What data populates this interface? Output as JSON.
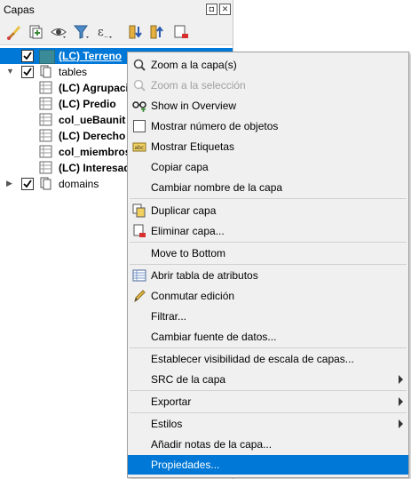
{
  "panel": {
    "title": "Capas",
    "float_glyph": "◘",
    "close_glyph": "✕"
  },
  "toolbar": {
    "tools": [
      "brush-icon",
      "add-group-icon",
      "eye-icon",
      "filter-icon",
      "expression-icon",
      "expand-all-icon",
      "collapse-all-icon",
      "remove-layer-icon"
    ]
  },
  "tree": {
    "items": [
      {
        "label": "(LC) Terreno",
        "selected": true
      },
      {
        "label": "tables"
      },
      {
        "label": "(LC) Agrupación"
      },
      {
        "label": "(LC) Predio"
      },
      {
        "label": "col_ueBaunit"
      },
      {
        "label": "(LC) Derecho"
      },
      {
        "label": "col_miembros"
      },
      {
        "label": "(LC) Interesado"
      },
      {
        "label": "domains"
      }
    ]
  },
  "menu": {
    "items": [
      {
        "label": "Zoom a la capa(s)"
      },
      {
        "label": "Zoom a la selección",
        "disabled": true
      },
      {
        "label": "Show in Overview"
      },
      {
        "label": "Mostrar número de objetos"
      },
      {
        "label": "Mostrar Etiquetas"
      },
      {
        "label": "Copiar capa"
      },
      {
        "label": "Cambiar nombre de la capa"
      },
      {
        "label": "Duplicar capa"
      },
      {
        "label": "Eliminar capa..."
      },
      {
        "label": "Move to Bottom"
      },
      {
        "label": "Abrir tabla de atributos"
      },
      {
        "label": "Conmutar edición"
      },
      {
        "label": "Filtrar..."
      },
      {
        "label": "Cambiar fuente de datos..."
      },
      {
        "label": "Establecer visibilidad de escala de capas..."
      },
      {
        "label": "SRC de la capa"
      },
      {
        "label": "Exportar"
      },
      {
        "label": "Estilos"
      },
      {
        "label": "Añadir notas de la capa..."
      },
      {
        "label": "Propiedades...",
        "highlighted": true
      }
    ]
  },
  "colors": {
    "selection": "#0078d7",
    "swatch": "#3a8a98"
  }
}
